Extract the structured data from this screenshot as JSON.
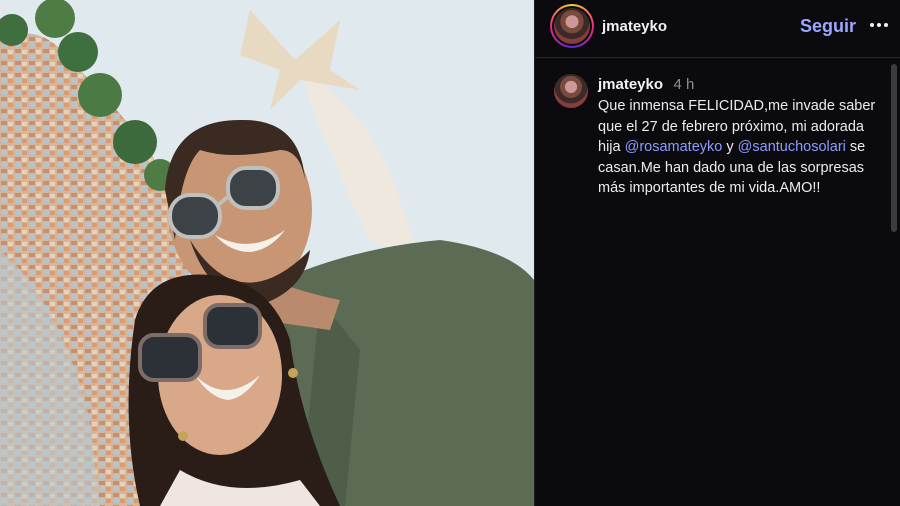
{
  "header": {
    "username": "jmateyko",
    "follow_label": "Seguir",
    "more_icon": "more-horizontal-icon"
  },
  "caption": {
    "username": "jmateyko",
    "time": "4 h",
    "text_1": "Que inmensa FELICIDAD,me invade saber que el 27 de febrero próximo, mi adorada hija ",
    "mention_1": "@rosamateyko",
    "text_2": " y ",
    "mention_2": "@santuchosolari",
    "text_3": " se casan.Me han dado una de las sorpresas más importantes de mi vida.AMO!!"
  },
  "colors": {
    "panel_bg": "#0b0b0f",
    "follow": "#9fa6ff",
    "mention": "#8f9bff"
  }
}
